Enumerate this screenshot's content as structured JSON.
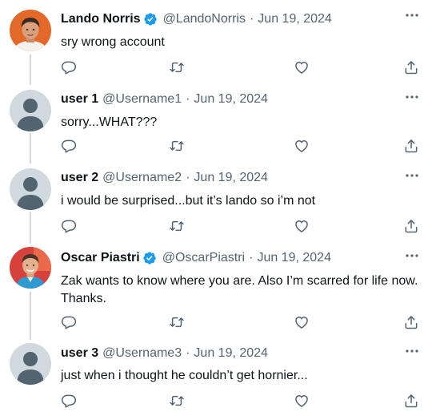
{
  "colors": {
    "text_primary": "#0f1419",
    "text_secondary": "#536471",
    "icon": "#536471",
    "verified": "#1d9bf0",
    "thread_line": "#cfd9de",
    "default_avatar_bg": "#cfd9de",
    "default_avatar_fg": "#536471"
  },
  "tweets": [
    {
      "name": "Lando Norris",
      "verified": true,
      "handle": "@LandoNorris",
      "separator": "·",
      "date": "Jun 19, 2024",
      "text": "sry wrong account",
      "avatar": "lando-norris-photo"
    },
    {
      "name": "user 1",
      "verified": false,
      "handle": "@Username1",
      "separator": "·",
      "date": "Jun 19, 2024",
      "text": "sorry...WHAT???",
      "avatar": "default-avatar"
    },
    {
      "name": "user 2",
      "verified": false,
      "handle": "@Username2",
      "separator": "·",
      "date": "Jun 19, 2024",
      "text": "i would be surprised...but it’s lando so i’m not",
      "avatar": "default-avatar"
    },
    {
      "name": "Oscar Piastri",
      "verified": true,
      "handle": "@OscarPiastri",
      "separator": "·",
      "date": "Jun 19, 2024",
      "text": "Zak wants to know where you are. Also I’m scarred for life now. Thanks.",
      "avatar": "oscar-piastri-photo"
    },
    {
      "name": "user 3",
      "verified": false,
      "handle": "@Username3",
      "separator": "·",
      "date": "Jun 19, 2024",
      "text": "just when i thought he couldn’t get hornier...",
      "avatar": "default-avatar"
    }
  ],
  "icons": {
    "more": "more-dots-icon",
    "reply": "reply-bubble-icon",
    "retweet": "retweet-icon",
    "like": "heart-icon",
    "share": "share-upload-icon",
    "verified": "verified-badge-icon"
  }
}
